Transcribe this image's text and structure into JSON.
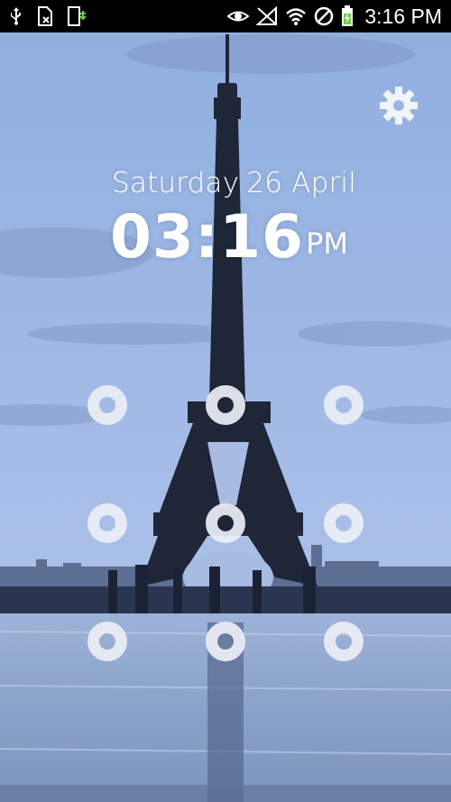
{
  "status_bar": {
    "time": "3:16 PM",
    "left_icons": [
      "usb-icon",
      "sim-card-icon",
      "download-icon"
    ],
    "right_icons": [
      "eye-icon",
      "no-signal-icon",
      "wifi-icon",
      "blocked-icon",
      "battery-charging-icon"
    ]
  },
  "lockscreen": {
    "day": "Saturday",
    "date": "26 April",
    "time": "03:16",
    "ampm": "PM",
    "settings_icon": "gear-icon"
  },
  "pattern": {
    "rows": 3,
    "cols": 3
  },
  "colors": {
    "status_bar_bg": "#000000",
    "text": "#ffffff",
    "dot_ring": "#ebeef5"
  }
}
